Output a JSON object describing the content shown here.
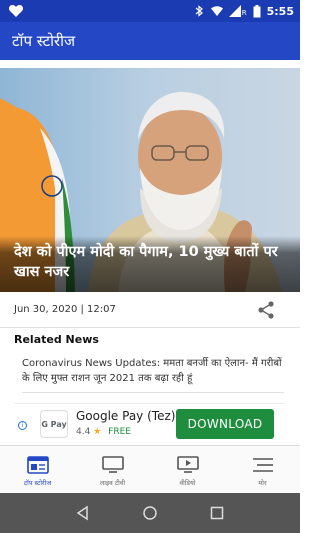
{
  "status_bar": {
    "time": "5:55",
    "icons": [
      "heart-icon",
      "bluetooth-icon",
      "wifi-icon",
      "signal-icon",
      "battery-icon"
    ],
    "signal_label": "R"
  },
  "app_bar": {
    "title": "टॉप स्टोरीज"
  },
  "hero": {
    "headline": "देश को पीएम मोदी का पैगाम, 10 मुख्य बातों पर खास नजर",
    "image": "speaker-photo"
  },
  "meta": {
    "date": "Jun 30, 2020 | 12:07",
    "share_icon": "share-icon"
  },
  "related": {
    "title": "Related News",
    "items": [
      {
        "text": "Coronavirus News Updates: ममता बनर्जी का ऐलान- मैं गरीबों के लिए मुफ्त राशन जून 2021 तक बढ़ा रही हूं"
      }
    ]
  },
  "ad": {
    "app_name": "Google Pay (Tez)",
    "logo_text": "G Pay",
    "rating": "4.4",
    "star": "★",
    "price": "FREE",
    "button_label": "DOWNLOAD",
    "info_icon": "i"
  },
  "bottom_nav": {
    "items": [
      {
        "label": "टॉप स्टोरीज",
        "icon": "newspaper-icon",
        "active": true
      },
      {
        "label": "लाइव टीवी",
        "icon": "tv-icon",
        "active": false
      },
      {
        "label": "वीडियो",
        "icon": "video-icon",
        "active": false
      },
      {
        "label": "मोर",
        "icon": "menu-icon",
        "active": false
      }
    ]
  },
  "colors": {
    "status_bar": "#1a3bb2",
    "app_bar": "#2447c5",
    "download_button": "#1e8e3e",
    "active_nav": "#2447c5"
  }
}
